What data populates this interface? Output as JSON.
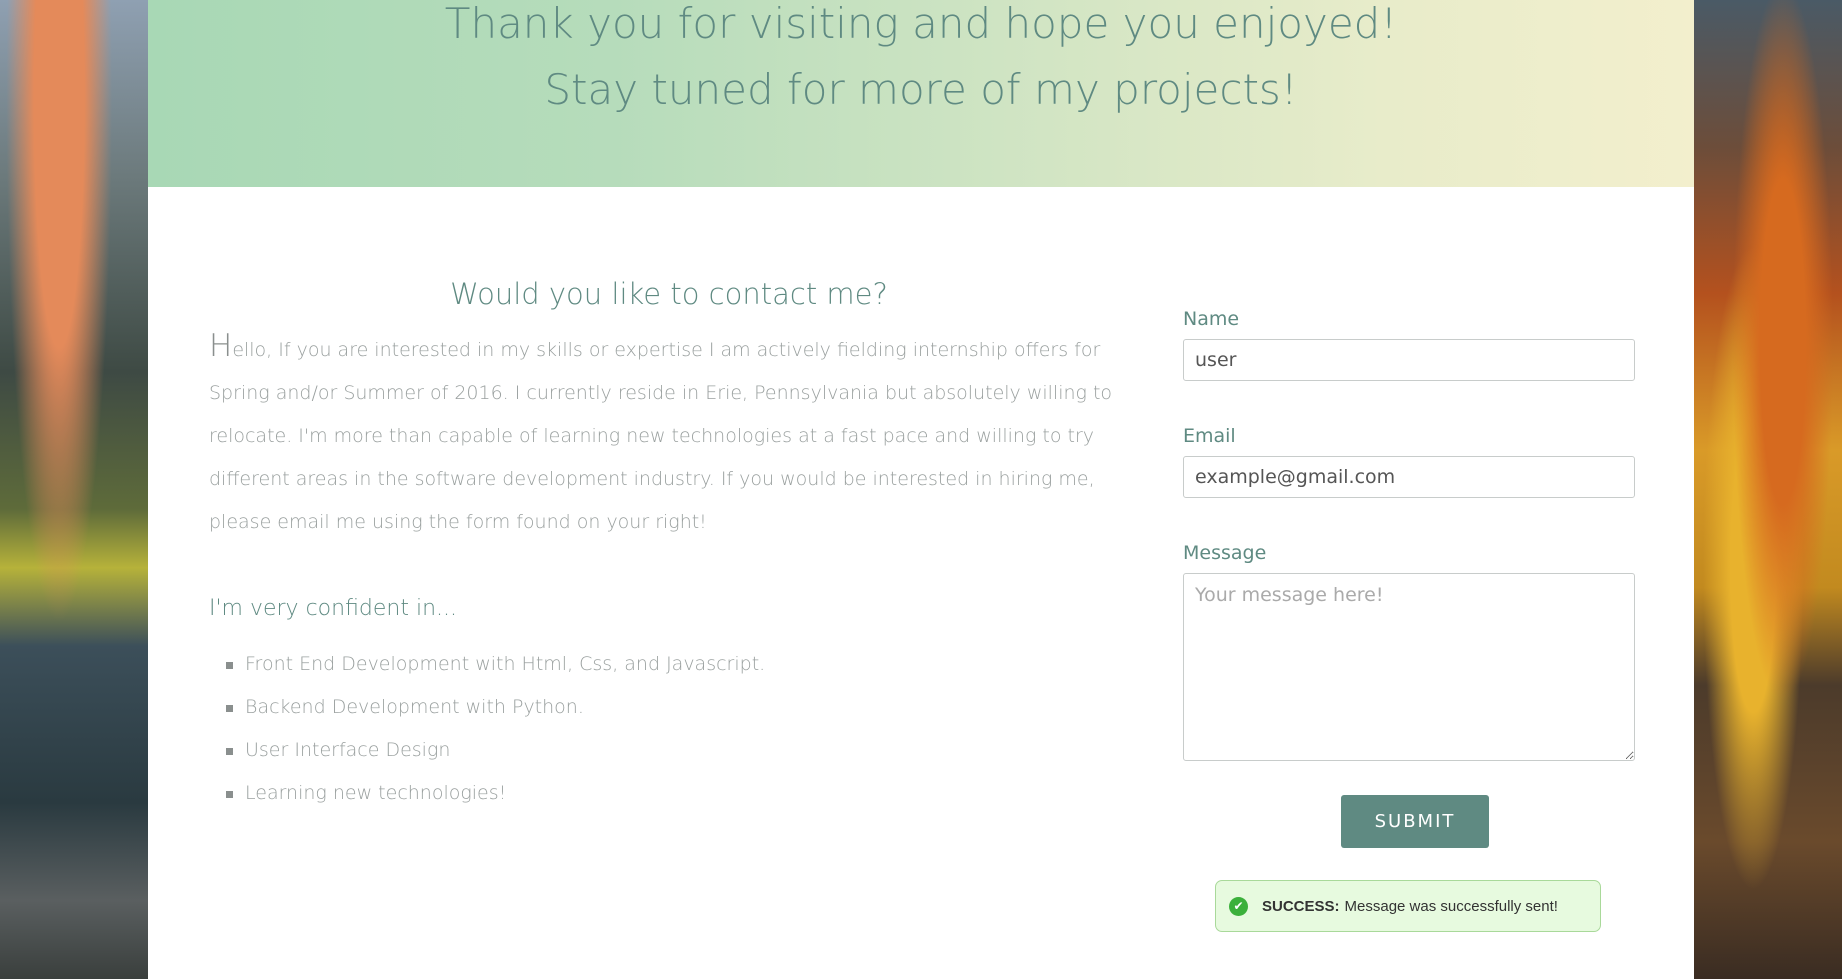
{
  "hero": {
    "line1": "Thank you for visiting and hope you enjoyed!",
    "line2": "Stay tuned for more of my projects!"
  },
  "contact": {
    "title": "Would you like to contact me?",
    "intro_initial": "H",
    "intro_rest": "ello, If you are interested in my skills or expertise I am actively fielding internship offers for Spring and/or Summer of 2016. I currently reside in Erie, Pennsylvania but absolutely willing to relocate. I'm more than capable of learning new technologies at a fast pace and willing to try different areas in the software development industry. If you would be interested in hiring me, please email me using the form found on your right!",
    "confident_heading": "I'm very confident in...",
    "skills": [
      "Front End Development with Html, Css, and Javascript.",
      "Backend Development with Python.",
      "User Interface Design",
      "Learning new technologies!"
    ]
  },
  "form": {
    "name_label": "Name",
    "name_value": "user",
    "email_label": "Email",
    "email_value": "example@gmail.com",
    "message_label": "Message",
    "message_placeholder": "Your message here!",
    "submit_label": "SUBMIT"
  },
  "alert": {
    "icon": "check-circle-icon",
    "strong": "SUCCESS:",
    "text": "Message was successfully sent!"
  },
  "colors": {
    "accent": "#5f8a82",
    "success_bg": "#e7fadf",
    "success_border": "#a9d99a"
  }
}
